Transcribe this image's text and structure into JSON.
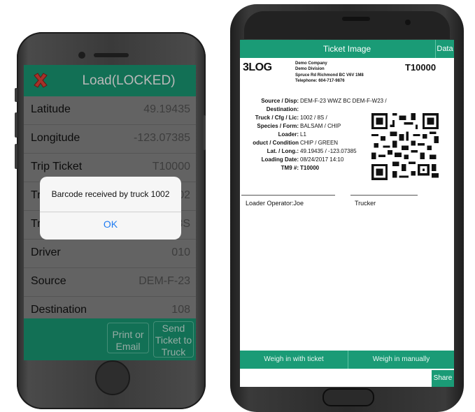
{
  "left_phone": {
    "header": {
      "title": "Load(LOCKED)"
    },
    "rows": [
      {
        "label": "Latitude",
        "value": "49.19435"
      },
      {
        "label": "Longitude",
        "value": "-123.07385"
      },
      {
        "label": "Trip Ticket",
        "value": "T10000"
      },
      {
        "label": "Tr",
        "value": "02"
      },
      {
        "label": "Tr",
        "value": "8S"
      },
      {
        "label": "Driver",
        "value": "010"
      },
      {
        "label": "Source",
        "value": "DEM-F-23"
      },
      {
        "label": "Destination",
        "value": "108"
      }
    ],
    "footer": {
      "print_email_label": "Print or\nEmail",
      "send_ticket_label": "Send\nTicket to\nTruck"
    },
    "alert": {
      "message": "Barcode received by truck 1002",
      "ok_label": "OK"
    },
    "colors": {
      "accent": "#1a9b76",
      "alert_button": "#1e7bf2"
    }
  },
  "right_phone": {
    "title_bar": {
      "title": "Ticket Image",
      "data_label": "Data"
    },
    "ticket": {
      "logo": "3LOG",
      "company_line1": "Demo Company",
      "company_line2": "Demo Division",
      "address": "Spruce Rd  Richmond BC  V6V 1M8",
      "telephone": "Telephone: 604-717-9876",
      "ticket_number": "T10000",
      "fields": [
        {
          "key": "Source / Disp:",
          "value": "DEM-F-23    WWZ BC DEM-F-W23 /"
        },
        {
          "key": "Destination:",
          "value": ""
        },
        {
          "key": "Truck / Cfg / Lic:",
          "value": "1002 / 8S /"
        },
        {
          "key": "Species / Form:",
          "value": "BALSAM / CHIP"
        },
        {
          "key": "Loader:",
          "value": "L1"
        },
        {
          "key": "oduct / Condition",
          "value": "CHIP / GREEN"
        },
        {
          "key": "Lat. / Long.:",
          "value": "49.19435 / -123.07385"
        },
        {
          "key": "Loading Date:",
          "value": "08/24/2017 14:10"
        },
        {
          "key": "TM9 #:",
          "value": "T10000"
        }
      ],
      "loader_operator_label": "Loader Operator:",
      "loader_operator_value": "Joe",
      "trucker_label": "Trucker"
    },
    "bottom_bar": {
      "weigh_ticket_label": "Weigh in with ticket",
      "weigh_manual_label": "Weigh in manually"
    },
    "share_label": "Share"
  }
}
